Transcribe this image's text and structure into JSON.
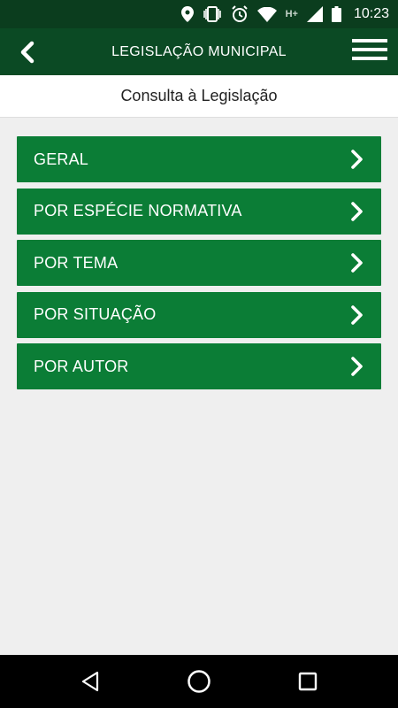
{
  "status_bar": {
    "time": "10:23",
    "network": "H+",
    "icons": [
      "location-icon",
      "vibrate-icon",
      "alarm-icon",
      "wifi-icon",
      "signal-icon",
      "battery-icon"
    ]
  },
  "app_bar": {
    "title": "LEGISLAÇÃO MUNICIPAL",
    "back_icon": "chevron-left-icon",
    "menu_icon": "hamburger-menu-icon"
  },
  "subheader": {
    "title": "Consulta à Legislação"
  },
  "menu": {
    "items": [
      {
        "label": "GERAL"
      },
      {
        "label": "POR ESPÉCIE NORMATIVA"
      },
      {
        "label": "POR TEMA"
      },
      {
        "label": "POR SITUAÇÃO"
      },
      {
        "label": "POR AUTOR"
      }
    ],
    "item_icon": "chevron-right-icon"
  },
  "nav_bar": {
    "buttons": [
      "back-triangle-icon",
      "home-circle-icon",
      "recents-square-icon"
    ]
  },
  "colors": {
    "status_bar": "#0b3d1e",
    "app_bar": "#0b4a24",
    "menu_item": "#0b7d36",
    "background": "#efefef"
  }
}
